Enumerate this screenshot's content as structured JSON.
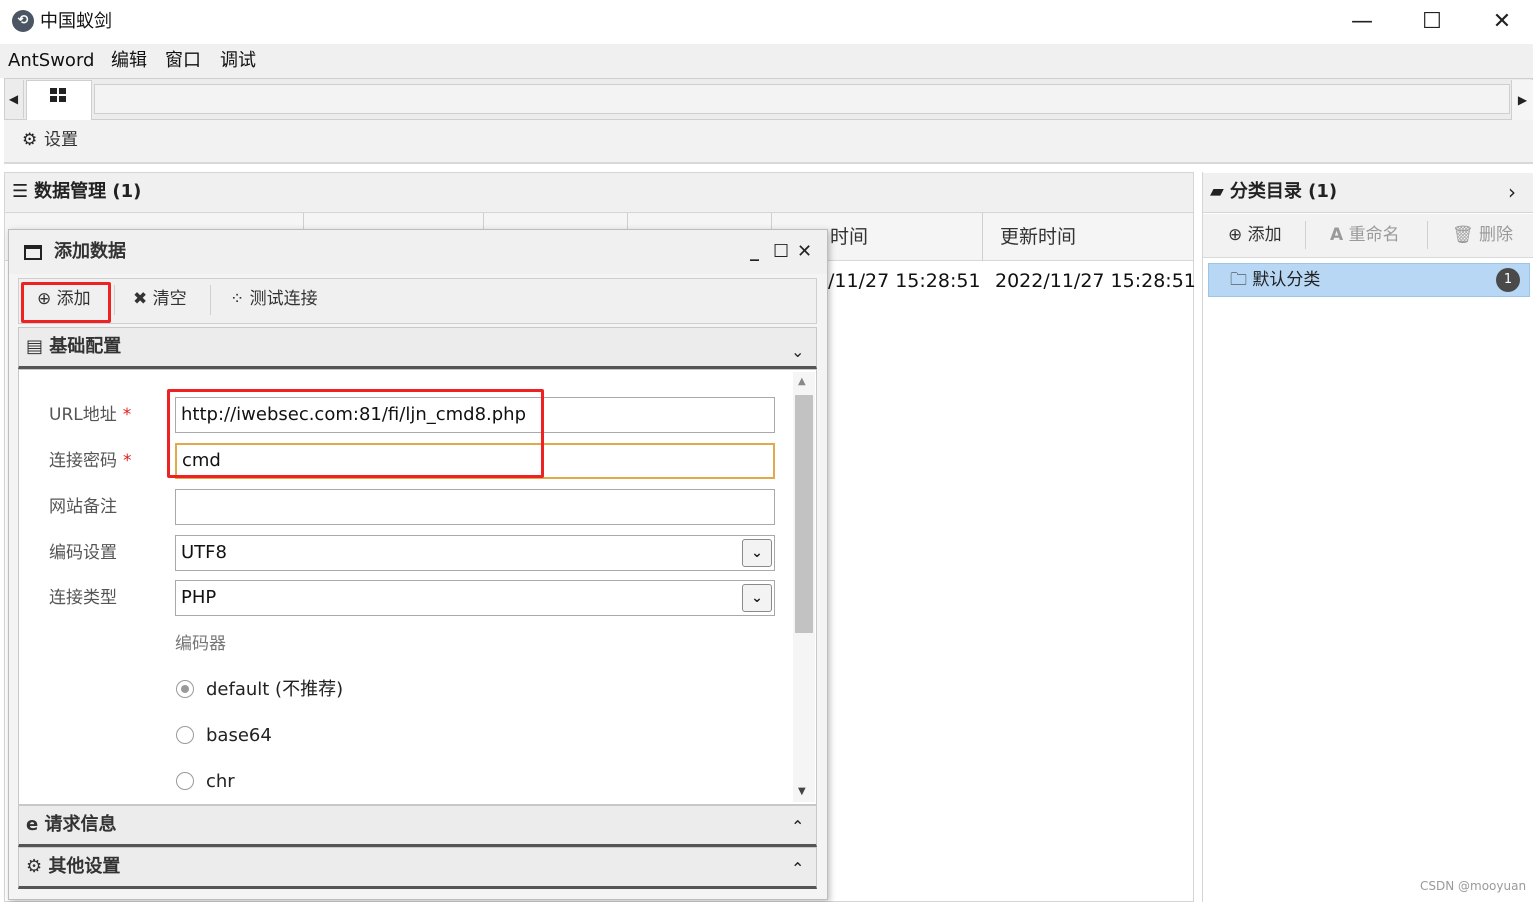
{
  "window": {
    "title": "中国蚁剑",
    "controls": {
      "minimize": "—",
      "maximize": "☐",
      "close": "✕"
    }
  },
  "menubar": [
    "AntSword",
    "编辑",
    "窗口",
    "调试"
  ],
  "settings": {
    "label": "设置"
  },
  "data_panel": {
    "title": "数据管理 (1)",
    "columns": [
      "时间",
      "更新时间"
    ],
    "row": {
      "created": "/11/27 15:28:51",
      "updated": "2022/11/27 15:28:51"
    }
  },
  "category_panel": {
    "title": "分类目录 (1)",
    "toolbar": {
      "add": "添加",
      "rename": "重命名",
      "delete": "删除"
    },
    "items": [
      {
        "label": "默认分类",
        "count": "1"
      }
    ]
  },
  "modal": {
    "title": "添加数据",
    "toolbar": {
      "add": "添加",
      "clear": "清空",
      "test": "测试连接"
    },
    "sections": {
      "basic": "基础配置",
      "request": "请求信息",
      "other": "其他设置"
    },
    "fields": {
      "url": {
        "label": "URL地址",
        "required": "*",
        "value": "http://iwebsec.com:81/fi/ljn_cmd8.php"
      },
      "password": {
        "label": "连接密码",
        "required": "*",
        "value": "cmd"
      },
      "note": {
        "label": "网站备注",
        "value": ""
      },
      "encoding": {
        "label": "编码设置",
        "value": "UTF8"
      },
      "type": {
        "label": "连接类型",
        "value": "PHP"
      }
    },
    "encoder": {
      "label": "编码器",
      "options": [
        {
          "label": "default (不推荐)",
          "selected": true
        },
        {
          "label": "base64",
          "selected": false
        },
        {
          "label": "chr",
          "selected": false
        }
      ]
    }
  },
  "watermark": "CSDN @mooyuan",
  "colors": {
    "highlight_red": "#ee2222",
    "focus_orange": "#e0a94a",
    "selection_blue": "#b7d7f4"
  }
}
